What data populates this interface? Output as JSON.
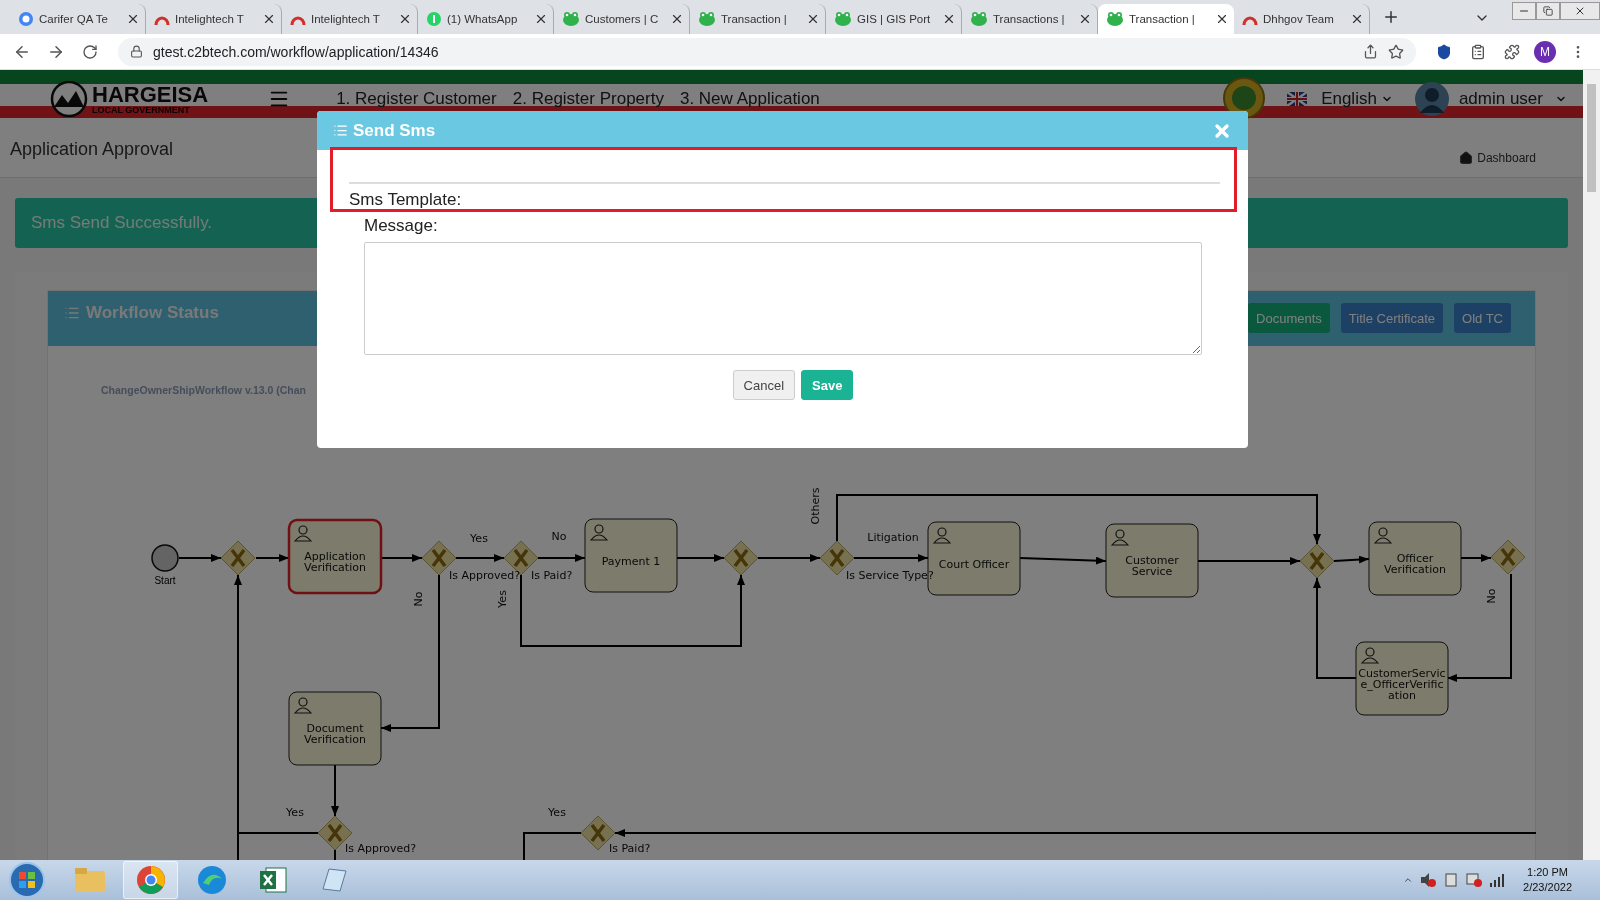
{
  "browser": {
    "tabs": [
      {
        "title": "Carifer QA Te",
        "kind": "google",
        "selected": false
      },
      {
        "title": "Intelightech T",
        "kind": "arch",
        "selected": false
      },
      {
        "title": "Intelightech T",
        "kind": "arch",
        "selected": false
      },
      {
        "title": "(1) WhatsApp",
        "kind": "whatsapp",
        "selected": false
      },
      {
        "title": "Customers | C",
        "kind": "frog",
        "selected": false
      },
      {
        "title": "Transaction |",
        "kind": "frog",
        "selected": false
      },
      {
        "title": "GIS | GIS Port",
        "kind": "frog",
        "selected": false
      },
      {
        "title": "Transactions |",
        "kind": "frog",
        "selected": false
      },
      {
        "title": "Transaction |",
        "kind": "frog",
        "selected": true
      },
      {
        "title": "Dhhgov Team",
        "kind": "arch",
        "selected": false
      }
    ],
    "url": "gtest.c2btech.com/workflow/application/14346",
    "profile_initial": "M"
  },
  "header": {
    "logo_title": "HARGEISA",
    "logo_subtitle": "LOCAL GOVERNMENT",
    "nav": [
      "1. Register Customer",
      "2. Register Property",
      "3. New Application"
    ],
    "language": "English",
    "user": "admin user"
  },
  "page_title": "Application Approval",
  "breadcrumb": "Dashboard",
  "alert": "Sms Send Successfully.",
  "workflow": {
    "title": "Workflow Status",
    "buttons": [
      {
        "label": "Documents",
        "kind": "success"
      },
      {
        "label": "Title Certificate",
        "kind": "primary"
      },
      {
        "label": "Old TC",
        "kind": "primary"
      }
    ],
    "diagram_title": "ChangeOwnerShipWorkflow v.13.0 (Chan",
    "start_label": "Start",
    "tasks": [
      {
        "label": "Application Verification",
        "active": true
      },
      {
        "label": "Payment 1",
        "active": false
      },
      {
        "label": "Court Officer",
        "active": false
      },
      {
        "label": "Customer Service",
        "active": false
      },
      {
        "label": "Officer Verification",
        "active": false
      },
      {
        "label": "CustomerService_OfficerVerification",
        "active": false
      },
      {
        "label": "Document Verification",
        "active": false
      }
    ],
    "gateway_labels": [
      "Is Approved?",
      "Is Paid?",
      "Is Service Type?",
      "Is Approved?",
      "Is Paid?"
    ],
    "edge_labels": [
      "Yes",
      "No",
      "No",
      "Yes",
      "Others",
      "Litigation",
      "No",
      "Yes",
      "Yes"
    ]
  },
  "modal": {
    "title": "Send Sms",
    "template_label": "Sms Template:",
    "message_label": "Message:",
    "buttons": [
      {
        "label": "Cancel",
        "kind": "default"
      },
      {
        "label": "Save",
        "kind": "success"
      }
    ]
  },
  "taskbar": {
    "time": "1:20 PM",
    "date": "2/23/2022"
  }
}
